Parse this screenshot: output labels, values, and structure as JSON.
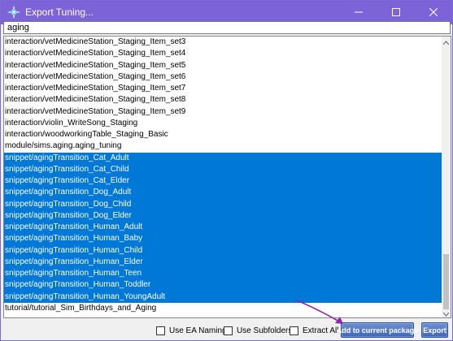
{
  "window": {
    "title": "Export Tuning...",
    "accent": "#7d63d8",
    "controls": {
      "minimize": "minimize-icon",
      "maximize": "maximize-icon",
      "close": "close-icon"
    }
  },
  "search": {
    "value": "aging"
  },
  "list": {
    "selection_color": "#0078d7",
    "items": [
      {
        "label": "interaction/vetMedicineStation_Staging_Item_set3",
        "selected": false
      },
      {
        "label": "interaction/vetMedicineStation_Staging_Item_set4",
        "selected": false
      },
      {
        "label": "interaction/vetMedicineStation_Staging_Item_set5",
        "selected": false
      },
      {
        "label": "interaction/vetMedicineStation_Staging_Item_set6",
        "selected": false
      },
      {
        "label": "interaction/vetMedicineStation_Staging_Item_set7",
        "selected": false
      },
      {
        "label": "interaction/vetMedicineStation_Staging_Item_set8",
        "selected": false
      },
      {
        "label": "interaction/vetMedicineStation_Staging_Item_set9",
        "selected": false
      },
      {
        "label": "interaction/violin_WriteSong_Staging",
        "selected": false
      },
      {
        "label": "interaction/woodworkingTable_Staging_Basic",
        "selected": false
      },
      {
        "label": "module/sims.aging.aging_tuning",
        "selected": false
      },
      {
        "label": "snippet/agingTransition_Cat_Adult",
        "selected": true
      },
      {
        "label": "snippet/agingTransition_Cat_Child",
        "selected": true
      },
      {
        "label": "snippet/agingTransition_Cat_Elder",
        "selected": true
      },
      {
        "label": "snippet/agingTransition_Dog_Adult",
        "selected": true
      },
      {
        "label": "snippet/agingTransition_Dog_Child",
        "selected": true
      },
      {
        "label": "snippet/agingTransition_Dog_Elder",
        "selected": true
      },
      {
        "label": "snippet/agingTransition_Human_Adult",
        "selected": true
      },
      {
        "label": "snippet/agingTransition_Human_Baby",
        "selected": true
      },
      {
        "label": "snippet/agingTransition_Human_Child",
        "selected": true
      },
      {
        "label": "snippet/agingTransition_Human_Elder",
        "selected": true
      },
      {
        "label": "snippet/agingTransition_Human_Teen",
        "selected": true
      },
      {
        "label": "snippet/agingTransition_Human_Toddler",
        "selected": true
      },
      {
        "label": "snippet/agingTransition_Human_YoungAdult",
        "selected": true
      },
      {
        "label": "tutorial/tutorial_Sim_Birthdays_and_Aging",
        "selected": false
      }
    ]
  },
  "footer": {
    "use_ea_naming": {
      "label": "Use EA Naming",
      "checked": false
    },
    "use_subfolders": {
      "label": "Use Subfolders",
      "checked": false
    },
    "extract_all": {
      "label": "Extract All",
      "checked": false
    },
    "add_button": "Add to current package",
    "export_button": "Export",
    "button_color": "#3f66b8",
    "annotation_color": "#8a2aa8"
  }
}
